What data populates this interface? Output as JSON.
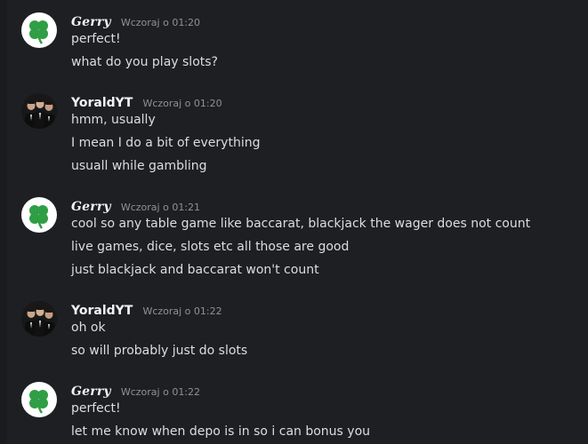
{
  "messages": [
    {
      "author": "Gerry",
      "avatar_icon": "clover-icon",
      "timestamp": "Wczoraj o 01:20",
      "lines": [
        "perfect!",
        "what do you play slots?"
      ]
    },
    {
      "author": "YoraldYT",
      "avatar_icon": "group-photo-avatar",
      "timestamp": "Wczoraj o 01:20",
      "lines": [
        "hmm, usually",
        "I mean I do a bit of everything",
        "usuall while gambling"
      ]
    },
    {
      "author": "Gerry",
      "avatar_icon": "clover-icon",
      "timestamp": "Wczoraj o 01:21",
      "lines": [
        "cool so any table game like baccarat, blackjack the wager does not count",
        "live games, dice, slots etc all those are good",
        "just blackjack and baccarat won't count"
      ]
    },
    {
      "author": "YoraldYT",
      "avatar_icon": "group-photo-avatar",
      "timestamp": "Wczoraj o 01:22",
      "lines": [
        "oh ok",
        "so will probably just do slots"
      ]
    },
    {
      "author": "Gerry",
      "avatar_icon": "clover-icon",
      "timestamp": "Wczoraj o 01:22",
      "lines": [
        "perfect!",
        "let me know when depo is in so i can bonus you"
      ]
    }
  ],
  "colors": {
    "background": "#1e1f22",
    "username": "#f2f3f5",
    "timestamp": "#8e9297",
    "text": "#dbdee1",
    "clover": "#2f9e44"
  }
}
